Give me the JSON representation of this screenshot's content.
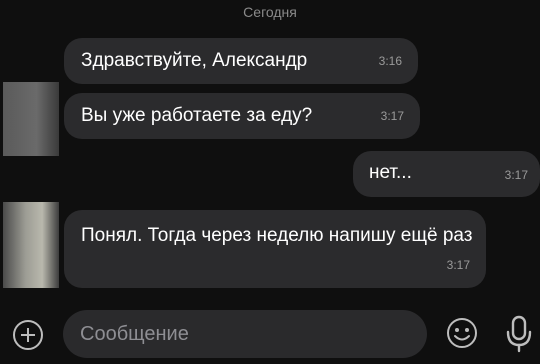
{
  "chat": {
    "date_label": "Сегодня",
    "messages": [
      {
        "direction": "incoming",
        "text": "Здравствуйте, Александр",
        "time": "3:16"
      },
      {
        "direction": "incoming",
        "text": "Вы уже работаете за еду?",
        "time": "3:17"
      },
      {
        "direction": "outgoing",
        "text": "нет...",
        "time": "3:17"
      },
      {
        "direction": "incoming",
        "text": "Понял. Тогда через неделю напишу ещё раз",
        "time": "3:17"
      }
    ]
  },
  "composer": {
    "placeholder": "Сообщение",
    "icons": [
      "plus-icon",
      "emoji-icon",
      "microphone-icon"
    ]
  },
  "colors": {
    "background": "#0f0f0f",
    "bubble": "#2b2b2d",
    "text": "#ffffff",
    "muted": "#8e8e93"
  }
}
